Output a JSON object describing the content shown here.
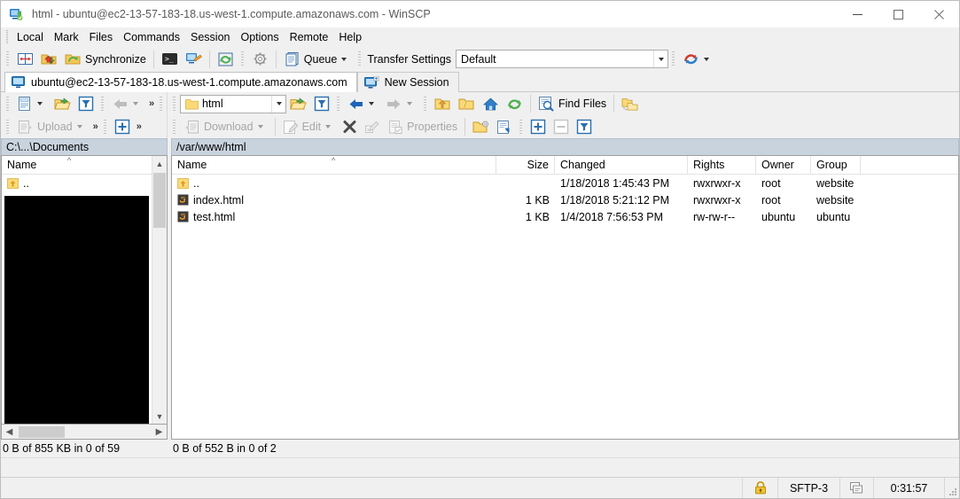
{
  "window": {
    "title": "html - ubuntu@ec2-13-57-183-18.us-west-1.compute.amazonaws.com - WinSCP",
    "app_icon": "winscp-icon",
    "minimize_label": "Minimize",
    "maximize_label": "Maximize",
    "close_label": "Close"
  },
  "menubar": {
    "items": [
      {
        "label": "Local",
        "name": "menu-local"
      },
      {
        "label": "Mark",
        "name": "menu-mark"
      },
      {
        "label": "Files",
        "name": "menu-files"
      },
      {
        "label": "Commands",
        "name": "menu-commands"
      },
      {
        "label": "Session",
        "name": "menu-session"
      },
      {
        "label": "Options",
        "name": "menu-options"
      },
      {
        "label": "Remote",
        "name": "menu-remote"
      },
      {
        "label": "Help",
        "name": "menu-help"
      }
    ]
  },
  "toolbar": {
    "synchronize_label": "Synchronize",
    "queue_label": "Queue",
    "transfer_settings_label": "Transfer Settings",
    "transfer_settings_value": "Default",
    "transfer_settings_placeholder": "Default"
  },
  "tabs": {
    "session_tab_label": "ubuntu@ec2-13-57-183-18.us-west-1.compute.amazonaws.com",
    "new_session_label": "New Session"
  },
  "local_toolbar": {
    "upload_label": "Upload",
    "path_value": ""
  },
  "remote_toolbar": {
    "path_value": "html",
    "find_files_label": "Find Files",
    "download_label": "Download",
    "edit_label": "Edit",
    "properties_label": "Properties"
  },
  "left_panel": {
    "path": "C:\\...\\Documents",
    "columns": [
      "Name"
    ],
    "sort_column": "Name",
    "sort_direction": "asc",
    "rows": [
      {
        "name": "..",
        "icon": "parent-folder-icon"
      }
    ],
    "status": "0 B of 855 KB in 0 of 59"
  },
  "right_panel": {
    "path": "/var/www/html",
    "columns": [
      "Name",
      "Size",
      "Changed",
      "Rights",
      "Owner",
      "Group"
    ],
    "sort_column": "Name",
    "sort_direction": "asc",
    "rows": [
      {
        "name": "..",
        "icon": "parent-folder-icon",
        "size": "",
        "changed": "1/18/2018 1:45:43 PM",
        "rights": "rwxrwxr-x",
        "owner": "root",
        "group": "website"
      },
      {
        "name": "index.html",
        "icon": "html-file-icon",
        "size": "1 KB",
        "changed": "1/18/2018 5:21:12 PM",
        "rights": "rwxrwxr-x",
        "owner": "root",
        "group": "website"
      },
      {
        "name": "test.html",
        "icon": "html-file-icon",
        "size": "1 KB",
        "changed": "1/4/2018 7:56:53 PM",
        "rights": "rw-rw-r--",
        "owner": "ubuntu",
        "group": "ubuntu"
      }
    ],
    "status": "0 B of 552 B in 0 of 2"
  },
  "statusbar": {
    "lock_icon": "padlock-icon",
    "protocol": "SFTP-3",
    "transfer_icon": "transfer-icon",
    "elapsed": "0:31:57"
  },
  "colors": {
    "path_bar_bg": "#c9d3de",
    "window_bg": "#f0f0f0",
    "list_bg": "#ffffff",
    "accent_blue": "#1f6fc4",
    "folder_yellow": "#ffd24d",
    "html_orange": "#f16529"
  }
}
